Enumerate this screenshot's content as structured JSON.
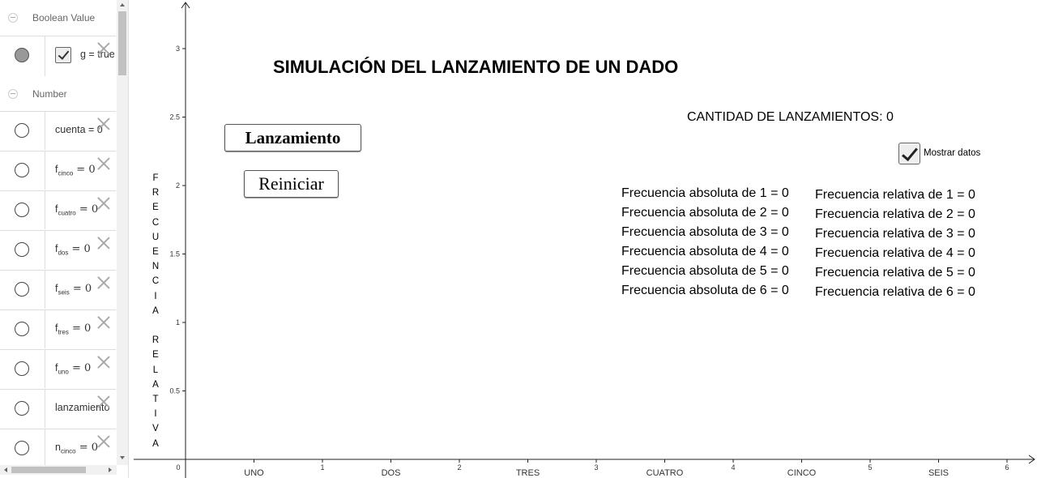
{
  "algebra": {
    "sections": [
      {
        "label": "Boolean Value"
      },
      {
        "label": "Number"
      }
    ],
    "rows": [
      {
        "name": "g",
        "expr": "g = true"
      },
      {
        "name": "cuenta",
        "expr": "cuenta = 0"
      },
      {
        "base": "f",
        "sub": "cinco",
        "eq": " = 0"
      },
      {
        "base": "f",
        "sub": "cuatro",
        "eq": " = 0"
      },
      {
        "base": "f",
        "sub": "dos",
        "eq": " = 0"
      },
      {
        "base": "f",
        "sub": "seis",
        "eq": " = 0"
      },
      {
        "base": "f",
        "sub": "tres",
        "eq": " = 0"
      },
      {
        "base": "f",
        "sub": "uno",
        "eq": " = 0"
      },
      {
        "name": "lanzamiento",
        "expr": "lanzamiento"
      },
      {
        "base": "n",
        "sub": "cinco",
        "eq": " = 0"
      }
    ]
  },
  "graphics": {
    "title": "SIMULACIÓN DEL LANZAMIENTO DE UN DADO",
    "buttons": {
      "launch": "Lanzamiento",
      "reset": "Reiniciar"
    },
    "count_label": "CANTIDAD DE LANZAMIENTOS: 0",
    "show_data_label": "Mostrar datos",
    "show_data_checked": true,
    "y_axis_label": "F\nR\nE\nC\nU\nE\nN\nC\nI\nA\n\nR\nE\nL\nA\nT\nI\nV\nA",
    "absolute": [
      "Frecuencia absoluta de 1 = 0",
      "Frecuencia absoluta de 2 = 0",
      "Frecuencia absoluta de 3 = 0",
      "Frecuencia absoluta de 4 = 0",
      "Frecuencia absoluta de 5 = 0",
      "Frecuencia absoluta de 6 = 0"
    ],
    "relative": [
      "Frecuencia relativa de 1 =  0",
      "Frecuencia relativa de 2 =  0",
      "Frecuencia relativa de 3 =  0",
      "Frecuencia relativa de 4 =  0",
      "Frecuencia relativa de 5 =  0",
      "Frecuencia relativa de 6 =  0"
    ],
    "x_ticks": [
      "0",
      "1",
      "2",
      "3",
      "4",
      "5",
      "6"
    ],
    "y_ticks": [
      "0.5",
      "1",
      "1.5",
      "2",
      "2.5",
      "3"
    ],
    "categories": [
      "UNO",
      "DOS",
      "TRES",
      "CUATRO",
      "CINCO",
      "SEIS"
    ]
  }
}
